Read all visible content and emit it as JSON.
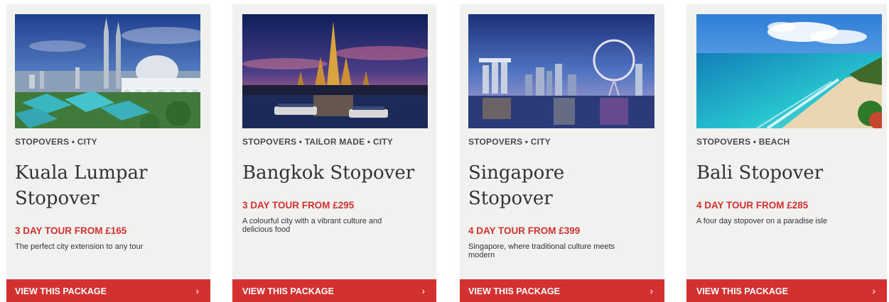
{
  "colors": {
    "accent": "#d2312f",
    "card_bg": "#f1f1f0",
    "text": "#333333"
  },
  "cards": [
    {
      "image": "kuala-lumpur-skyline-photo",
      "tags": "STOPOVERS • CITY",
      "title": "Kuala Lumpar Stopover",
      "price": "3 DAY TOUR FROM £165",
      "description": "The perfect city extension to any tour",
      "cta": "VIEW THIS PACKAGE",
      "chevron": "›"
    },
    {
      "image": "bangkok-temple-photo",
      "tags": "STOPOVERS • TAILOR MADE • CITY",
      "title": "Bangkok Stopover",
      "price": "3 DAY TOUR FROM £295",
      "description": "A colourful city with a vibrant culture and delicious food",
      "cta": "VIEW THIS PACKAGE",
      "chevron": "›"
    },
    {
      "image": "singapore-skyline-photo",
      "tags": "STOPOVERS • CITY",
      "title": "Singapore Stopover",
      "price": "4 DAY TOUR FROM £399",
      "description": "Singapore, where traditional culture meets modern",
      "cta": "VIEW THIS PACKAGE",
      "chevron": "›"
    },
    {
      "image": "bali-beach-photo",
      "tags": "STOPOVERS • BEACH",
      "title": "Bali Stopover",
      "price": "4 DAY TOUR FROM £285",
      "description": "A four day stopover on a paradise isle",
      "cta": "VIEW THIS PACKAGE",
      "chevron": "›"
    }
  ]
}
